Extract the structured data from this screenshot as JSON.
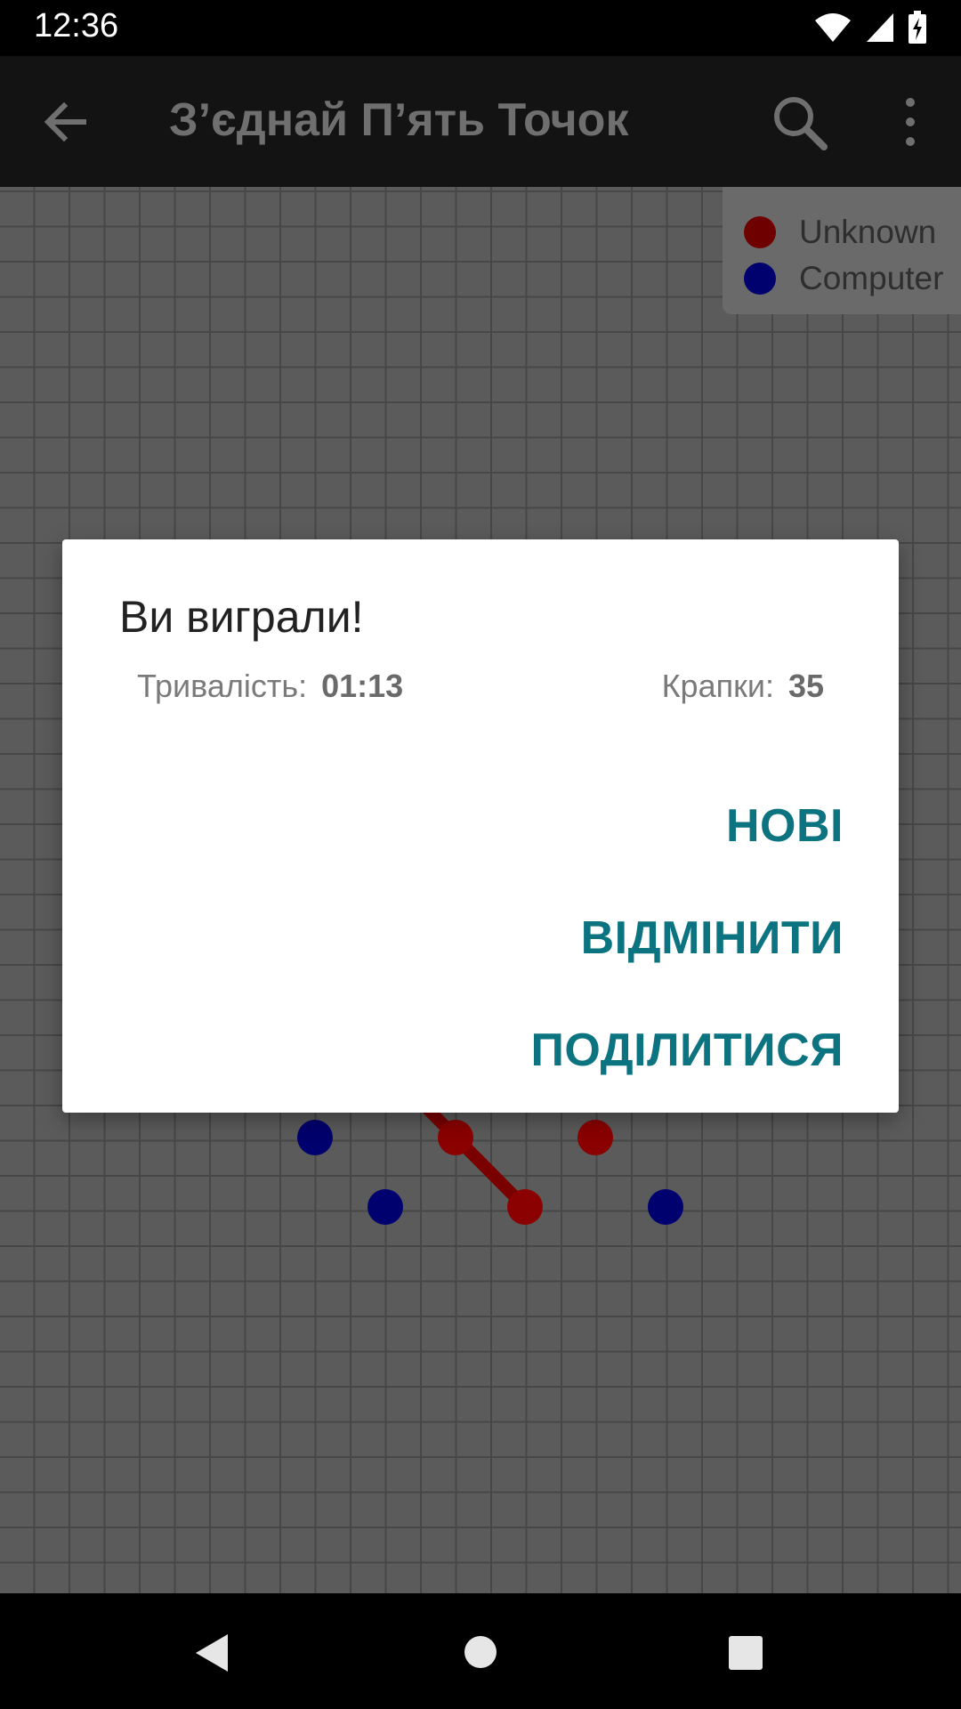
{
  "status_bar": {
    "time": "12:36"
  },
  "toolbar": {
    "title": "З’єднай П’ять Точок"
  },
  "legend": {
    "players": [
      {
        "name": "Unknown",
        "color": "#8b0000"
      },
      {
        "name": "Computer",
        "color": "#00008b"
      }
    ]
  },
  "dialog": {
    "title": "Ви виграли!",
    "duration_label": "Тривалість:",
    "duration_value": "01:13",
    "dots_label": "Крапки:",
    "dots_value": "35",
    "buttons": {
      "new": "НОВІ",
      "undo": "ВІДМІНИТИ",
      "share": "ПОДІЛИТИСЯ"
    }
  },
  "colors": {
    "accent": "#0b7480",
    "player_red": "#8b0000",
    "player_blue": "#00008b"
  }
}
